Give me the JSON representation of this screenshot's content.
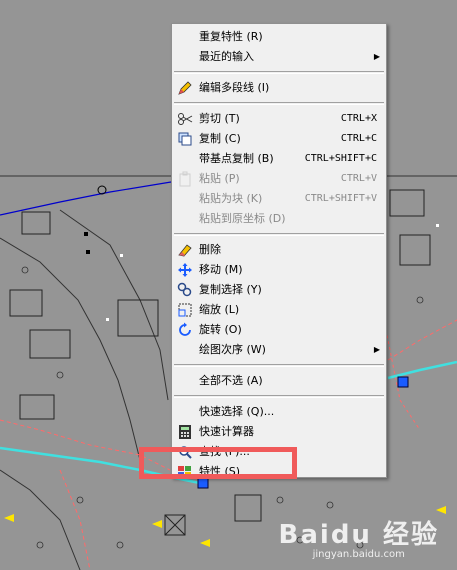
{
  "menu": {
    "items": [
      {
        "label": "重复特性 (R)",
        "icon": "",
        "enabled": true
      },
      {
        "label": "最近的输入",
        "icon": "",
        "enabled": true,
        "submenu": true
      },
      {
        "separator": true
      },
      {
        "label": "编辑多段线 (I)",
        "icon": "pencil-icon",
        "enabled": true
      },
      {
        "separator": true
      },
      {
        "label": "剪切 (T)",
        "icon": "scissors-icon",
        "enabled": true,
        "shortcut": "CTRL+X"
      },
      {
        "label": "复制 (C)",
        "icon": "copy-icon",
        "enabled": true,
        "shortcut": "CTRL+C"
      },
      {
        "label": "带基点复制 (B)",
        "icon": "",
        "enabled": true,
        "shortcut": "CTRL+SHIFT+C"
      },
      {
        "label": "粘贴 (P)",
        "icon": "paste-icon",
        "enabled": false,
        "shortcut": "CTRL+V"
      },
      {
        "label": "粘贴为块 (K)",
        "icon": "",
        "enabled": false,
        "shortcut": "CTRL+SHIFT+V"
      },
      {
        "label": "粘贴到原坐标 (D)",
        "icon": "",
        "enabled": false
      },
      {
        "separator": true
      },
      {
        "label": "删除",
        "icon": "eraser-icon",
        "enabled": true
      },
      {
        "label": "移动 (M)",
        "icon": "move-icon",
        "enabled": true
      },
      {
        "label": "复制选择 (Y)",
        "icon": "copy-selection-icon",
        "enabled": true
      },
      {
        "label": "缩放 (L)",
        "icon": "scale-icon",
        "enabled": true
      },
      {
        "label": "旋转 (O)",
        "icon": "rotate-icon",
        "enabled": true
      },
      {
        "label": "绘图次序 (W)",
        "icon": "",
        "enabled": true,
        "submenu": true
      },
      {
        "separator": true
      },
      {
        "label": "全部不选 (A)",
        "icon": "",
        "enabled": true
      },
      {
        "separator": true
      },
      {
        "label": "快速选择 (Q)...",
        "icon": "",
        "enabled": true
      },
      {
        "label": "快速计算器",
        "icon": "calculator-icon",
        "enabled": true
      },
      {
        "label": "查找 (F)...",
        "icon": "find-icon",
        "enabled": true
      },
      {
        "label": "特性 (S)",
        "icon": "properties-icon",
        "enabled": true
      }
    ]
  },
  "watermark": {
    "logo": "Baidu 经验",
    "url": "jingyan.baidu.com"
  },
  "colors": {
    "background": "#959595",
    "menu_bg": "#f0f0f0",
    "highlight": "#f05a5a",
    "polyline": "#40e0e0",
    "grip": "#1a5cff"
  }
}
